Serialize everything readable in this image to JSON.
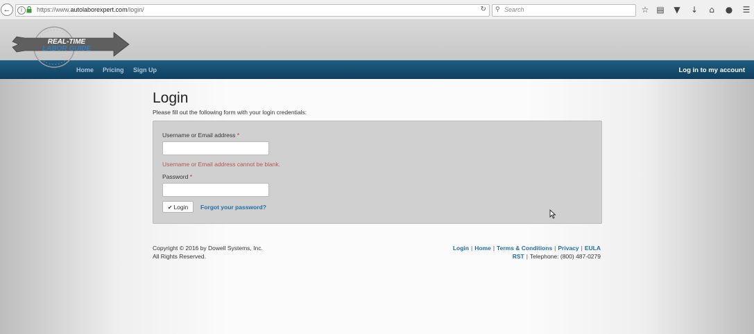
{
  "browser": {
    "url_prefix": "https://www.",
    "url_domain": "autolaborexpert.com",
    "url_path": "/login/",
    "search_placeholder": "Search",
    "icons": [
      "star-icon",
      "clipboard-icon",
      "pocket-icon",
      "download-icon",
      "home-icon",
      "chat-icon",
      "menu-icon"
    ]
  },
  "header": {
    "logo_line1": "REAL-TIME",
    "logo_line2": "LABOR GUIDE",
    "nav": [
      "Home",
      "Pricing",
      "Sign Up"
    ],
    "account_link": "Log in to my account"
  },
  "login": {
    "title": "Login",
    "subtitle": "Please fill out the following form with your login credentials:",
    "username_label": "Username or Email address",
    "username_value": "",
    "username_error": "Username or Email address cannot be blank.",
    "password_label": "Password",
    "password_value": "",
    "required_mark": "*",
    "submit_label": "Login",
    "forgot_link": "Forgot your password?"
  },
  "footer": {
    "copyright_line1": "Copyright © 2016 by Dowell Systems, Inc.",
    "copyright_line2": "All Rights Reserved.",
    "links": [
      "Login",
      "Home",
      "Terms & Conditions",
      "Privacy",
      "EULA"
    ],
    "rst_link": "RST",
    "telephone": "Telephone: (800) 487-0279"
  },
  "colors": {
    "nav_bar": "#14496b",
    "link": "#1f6fa8",
    "error": "#b8554f",
    "required": "#c9302c"
  }
}
